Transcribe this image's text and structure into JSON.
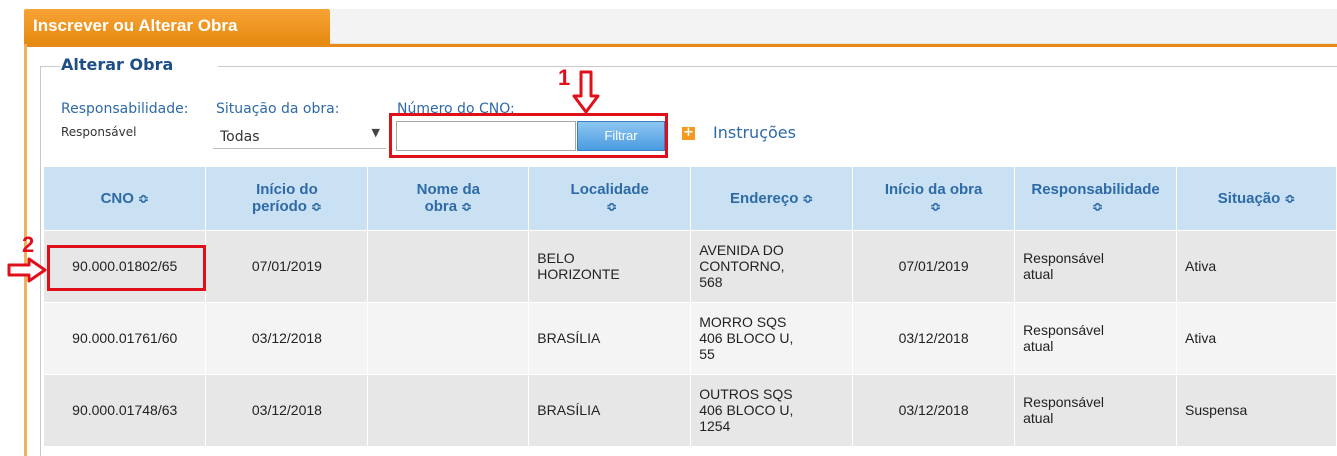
{
  "header": {
    "tab_title": "Inscrever ou Alterar Obra"
  },
  "section": {
    "legend": "Alterar Obra"
  },
  "filters": {
    "responsabilidade_label": "Responsabilidade:",
    "responsabilidade_value": "Responsável",
    "situacao_label": "Situação da obra:",
    "situacao_selected": "Todas",
    "cno_label": "Número do CNO:",
    "cno_value": "",
    "filter_button": "Filtrar",
    "instructions_link": "Instruções"
  },
  "annotations": {
    "mark1": "1",
    "mark2": "2"
  },
  "table": {
    "sort_glyph": "≎",
    "headers": {
      "cno": "CNO",
      "inicio_periodo_1": "Início do",
      "inicio_periodo_2": "período",
      "nome_obra_1": "Nome da",
      "nome_obra_2": "obra",
      "localidade": "Localidade",
      "endereco": "Endereço",
      "inicio_obra": "Início da obra",
      "responsabilidade": "Responsabilidade",
      "situacao": "Situação"
    },
    "rows": [
      {
        "cno": "90.000.01802/65",
        "inicio_periodo": "07/01/2019",
        "nome_obra": "",
        "localidade_1": "BELO",
        "localidade_2": "HORIZONTE",
        "endereco_1": "AVENIDA DO",
        "endereco_2": "CONTORNO,",
        "endereco_3": "568",
        "inicio_obra": "07/01/2019",
        "resp_1": "Responsável",
        "resp_2": "atual",
        "situacao": "Ativa"
      },
      {
        "cno": "90.000.01761/60",
        "inicio_periodo": "03/12/2018",
        "nome_obra": "",
        "localidade_1": "BRASÍLIA",
        "localidade_2": "",
        "endereco_1": "MORRO SQS",
        "endereco_2": "406 BLOCO U,",
        "endereco_3": "55",
        "inicio_obra": "03/12/2018",
        "resp_1": "Responsável",
        "resp_2": "atual",
        "situacao": "Ativa"
      },
      {
        "cno": "90.000.01748/63",
        "inicio_periodo": "03/12/2018",
        "nome_obra": "",
        "localidade_1": "BRASÍLIA",
        "localidade_2": "",
        "endereco_1": "OUTROS SQS",
        "endereco_2": "406 BLOCO U,",
        "endereco_3": "1254",
        "inicio_obra": "03/12/2018",
        "resp_1": "Responsável",
        "resp_2": "atual",
        "situacao": "Suspensa"
      }
    ]
  },
  "colors": {
    "brand_orange": "#e8891a",
    "link_blue": "#2e6aa7",
    "header_blue": "#c9e1f2",
    "annotation_red": "#e0101b"
  }
}
